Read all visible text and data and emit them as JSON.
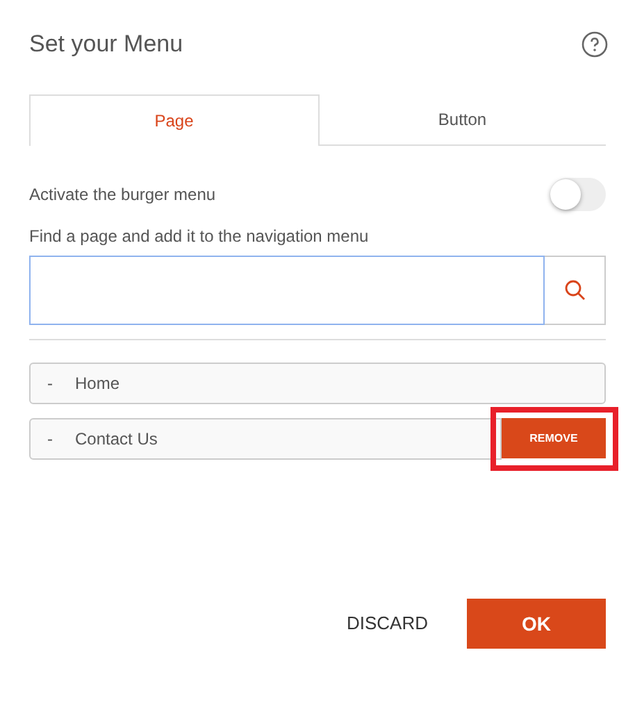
{
  "title": "Set your Menu",
  "tabs": [
    {
      "label": "Page",
      "selected": true
    },
    {
      "label": "Button",
      "selected": false
    }
  ],
  "burger_toggle": {
    "label": "Activate the burger menu",
    "on": false
  },
  "search": {
    "label": "Find a page and add it to the navigation menu",
    "focused": true
  },
  "menu_items": [
    {
      "marker": "-",
      "label": "Home",
      "show_remove": false,
      "highlighted": false
    },
    {
      "marker": "-",
      "label": "Contact Us",
      "show_remove": true,
      "remove_label": "REMOVE",
      "highlighted": true
    }
  ],
  "buttons": [
    {
      "label": "DISCARD",
      "kind": "text"
    },
    {
      "label": "OK",
      "kind": "primary"
    }
  ]
}
